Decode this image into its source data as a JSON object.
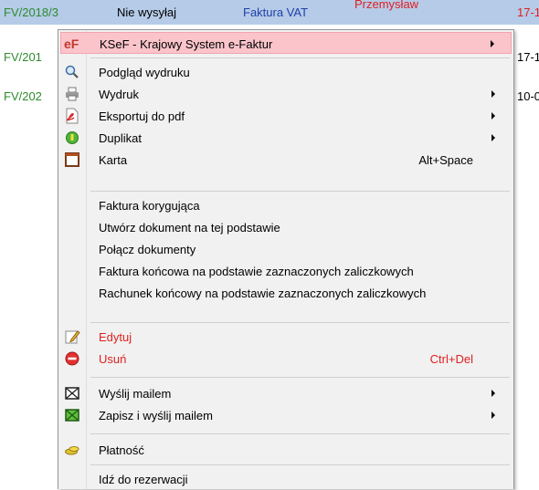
{
  "grid": {
    "rows": [
      {
        "number": "FV/2018/3",
        "status": "Nie wysyłaj",
        "type": "Faktura VAT",
        "person": "Przemysław",
        "date": "17-1"
      },
      {
        "number": "FV/201",
        "date": "17-1"
      },
      {
        "number": "FV/202",
        "date": "10-0"
      }
    ]
  },
  "menu": {
    "items": [
      {
        "label": "KSeF - Krajowy System e-Faktur",
        "icon": "ksef-logo-icon",
        "icon_text": "eF",
        "submenu": true
      },
      {
        "label": "Podgląd wydruku",
        "icon": "magnifier-icon"
      },
      {
        "label": "Wydruk",
        "icon": "printer-icon",
        "submenu": true
      },
      {
        "label": "Eksportuj do pdf",
        "icon": "pdf-icon",
        "submenu": true
      },
      {
        "label": "Duplikat",
        "icon": "duplicate-icon",
        "submenu": true
      },
      {
        "label": "Karta",
        "icon": "card-icon",
        "shortcut": "Alt+Space"
      },
      {
        "label": "Faktura korygująca"
      },
      {
        "label": "Utwórz dokument na tej podstawie"
      },
      {
        "label": "Połącz dokumenty"
      },
      {
        "label": "Faktura końcowa na podstawie zaznaczonych zaliczkowych"
      },
      {
        "label": "Rachunek końcowy na podstawie zaznaczonych zaliczkowych"
      },
      {
        "label": "Edytuj",
        "icon": "edit-icon"
      },
      {
        "label": "Usuń",
        "icon": "delete-icon",
        "shortcut": "Ctrl+Del"
      },
      {
        "label": "Wyślij mailem",
        "icon": "mail-icon",
        "submenu": true
      },
      {
        "label": "Zapisz i wyślij mailem",
        "icon": "save-mail-icon",
        "submenu": true
      },
      {
        "label": "Płatność",
        "icon": "coins-icon"
      },
      {
        "label": "Idź do rezerwacji"
      }
    ]
  },
  "colors": {
    "highlight": "#fbc4cb",
    "selected_row": "#b5cbe8",
    "number_text": "#2e8b2e",
    "danger_text": "#e02020",
    "link_text": "#1f3fa8"
  }
}
